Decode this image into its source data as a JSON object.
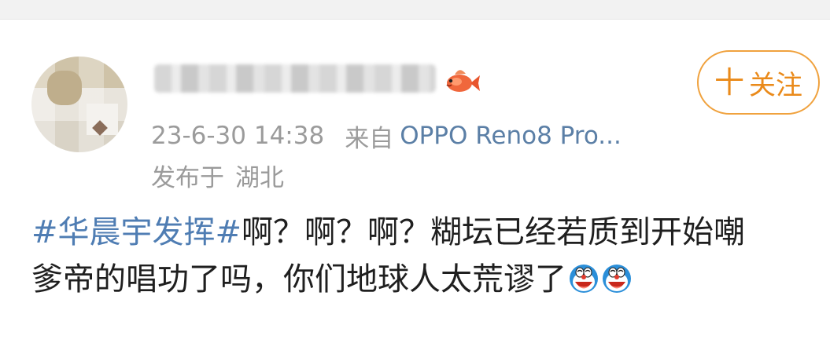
{
  "post": {
    "author": {
      "name_visible": false,
      "avatar_icon": "profile-avatar-blurred",
      "badge_icon": "koi-fish-icon"
    },
    "follow_button": {
      "plus": "十",
      "label": "关注"
    },
    "timestamp": "23-6-30 14:38",
    "source_prefix": "来自",
    "source_device": "OPPO Reno8 Pro...",
    "location_prefix": "发布于",
    "location": "湖北",
    "hashtag": "#华晨宇发挥#",
    "content_line1": "啊？啊？啊？糊坛已经若质到开始嘲",
    "content_line2": "爹帝的唱功了吗，你们地球人太荒谬了",
    "emojis": [
      "doraemon-laugh-emoji",
      "doraemon-laugh-emoji"
    ]
  },
  "colors": {
    "link_blue": "#4f7db3",
    "device_blue": "#5b7fa6",
    "follow_orange": "#ea8a1a",
    "meta_gray": "#9b9b9b"
  }
}
